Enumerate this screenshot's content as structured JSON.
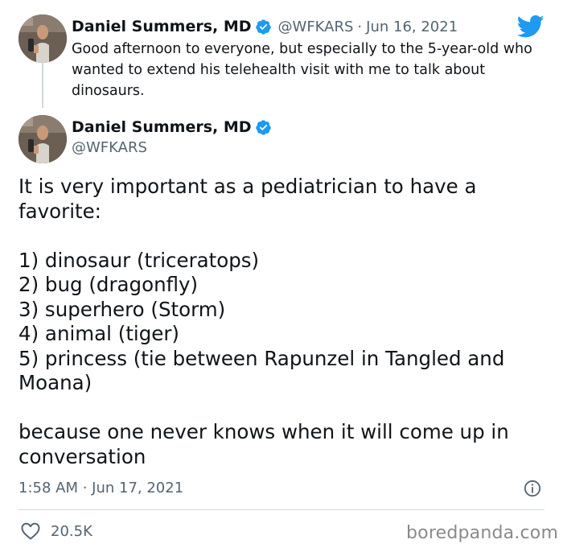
{
  "reply": {
    "author_name": "Daniel Summers, MD",
    "handle": "@WFKARS",
    "separator": "·",
    "date": "Jun 16, 2021",
    "text": "Good afternoon to everyone, but especially to the 5-year-old who wanted to extend his telehealth visit with me to talk about dinosaurs."
  },
  "main_tweet": {
    "author_name": "Daniel Summers, MD",
    "handle": "@WFKARS",
    "lines": [
      "It is very important as a pediatrician to have a favorite:",
      "",
      "1) dinosaur (triceratops)",
      "2) bug (dragonfly)",
      "3) superhero (Storm)",
      "4) animal (tiger)",
      "5) princess (tie between Rapunzel in Tangled and Moana)",
      "",
      "because one never knows when it will come up in conversation"
    ],
    "timestamp": "1:58 AM · Jun 17, 2021",
    "like_count": "20.5K"
  },
  "watermark": "boredpanda.com",
  "icons": {
    "brand": "twitter-bird-icon",
    "verified": "verified-badge-icon",
    "info": "info-icon",
    "like": "heart-icon"
  },
  "colors": {
    "twitter_blue": "#1d9bf0",
    "text_primary": "#0f1419",
    "text_secondary": "#536471",
    "divider": "#cfd9de"
  }
}
